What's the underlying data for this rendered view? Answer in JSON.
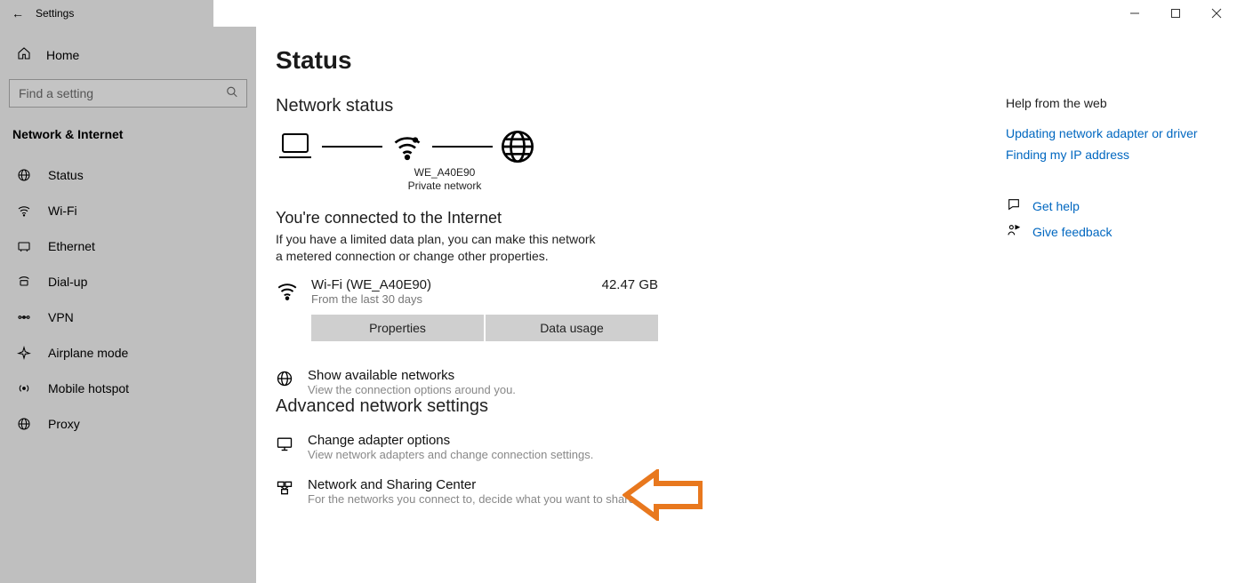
{
  "window": {
    "back_glyph": "←",
    "title": "Settings"
  },
  "sidebar": {
    "home_label": "Home",
    "search_placeholder": "Find a setting",
    "section_label": "Network & Internet",
    "items": [
      {
        "label": "Status"
      },
      {
        "label": "Wi-Fi"
      },
      {
        "label": "Ethernet"
      },
      {
        "label": "Dial-up"
      },
      {
        "label": "VPN"
      },
      {
        "label": "Airplane mode"
      },
      {
        "label": "Mobile hotspot"
      },
      {
        "label": "Proxy"
      }
    ]
  },
  "page": {
    "title": "Status",
    "network_status_heading": "Network status",
    "diagram": {
      "ssid": "WE_A40E90",
      "net_type": "Private network"
    },
    "connected_heading": "You're connected to the Internet",
    "connected_desc": "If you have a limited data plan, you can make this network a metered connection or change other properties.",
    "connection": {
      "name": "Wi-Fi (WE_A40E90)",
      "period": "From the last 30 days",
      "usage": "42.47 GB",
      "btn_properties": "Properties",
      "btn_data_usage": "Data usage"
    },
    "show_available": {
      "title": "Show available networks",
      "desc": "View the connection options around you."
    },
    "advanced_heading": "Advanced network settings",
    "change_adapter": {
      "title": "Change adapter options",
      "desc": "View network adapters and change connection settings."
    },
    "sharing_center": {
      "title": "Network and Sharing Center",
      "desc": "For the networks you connect to, decide what you want to share."
    }
  },
  "help": {
    "heading": "Help from the web",
    "links": [
      "Updating network adapter or driver",
      "Finding my IP address"
    ],
    "get_help": "Get help",
    "give_feedback": "Give feedback"
  }
}
